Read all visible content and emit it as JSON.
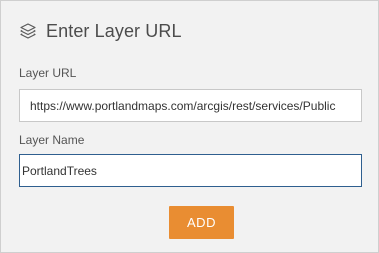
{
  "dialog": {
    "title": "Enter Layer URL",
    "icon": "layers-icon"
  },
  "form": {
    "layer_url": {
      "label": "Layer URL",
      "value": "https://www.portlandmaps.com/arcgis/rest/services/Public"
    },
    "layer_name": {
      "label": "Layer Name",
      "value": "PortlandTrees"
    },
    "add_label": "ADD"
  },
  "colors": {
    "accent": "#e98d32",
    "panel_bg": "#f2f2f2",
    "focus_border": "#2f5f8f"
  }
}
